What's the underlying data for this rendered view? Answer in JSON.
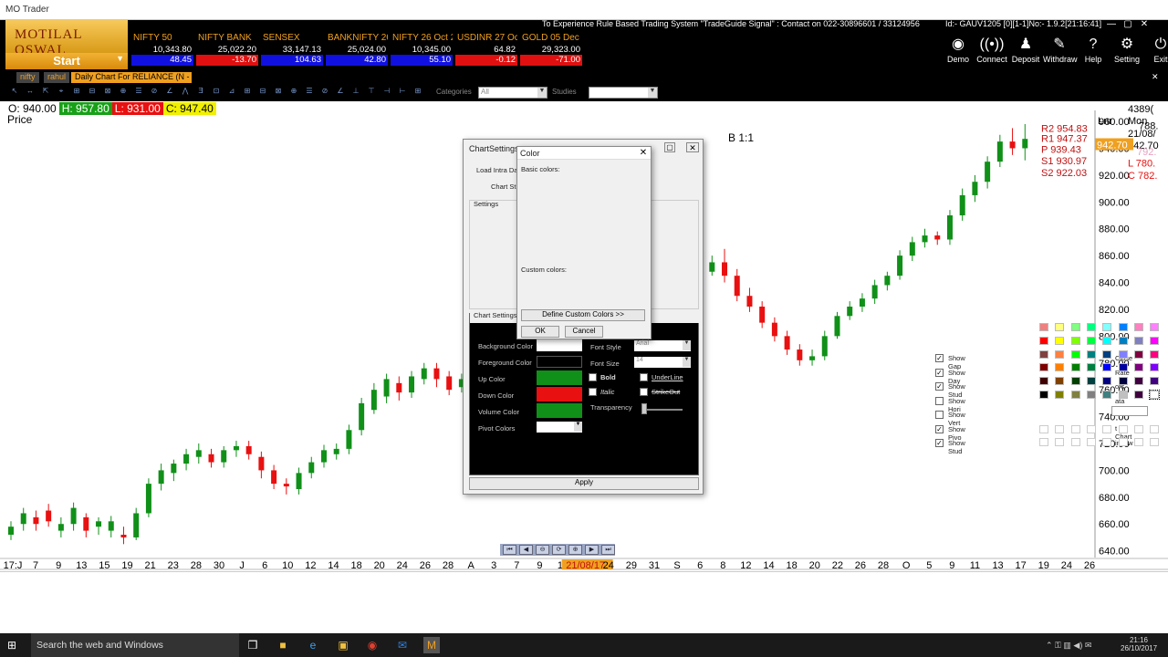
{
  "window": {
    "title": "MO Trader"
  },
  "header": {
    "logo": "MOTILAL OSWAL",
    "start": "Start",
    "marquee": "To Experience Rule Based Trading System \"TradeGuide Signal\" : Contact on 022-30896601 / 33124956",
    "id_text": "Id:- GAUV1205    [0][1-1]No:- 1.9.2[21:16:41]",
    "tickers": [
      {
        "name": "NIFTY 50",
        "value": "10,343.80",
        "change": "48.45",
        "dir": "up"
      },
      {
        "name": "NIFTY BANK",
        "value": "25,022.20",
        "change": "-13.70",
        "dir": "down"
      },
      {
        "name": "SENSEX",
        "value": "33,147.13",
        "change": "104.63",
        "dir": "up"
      },
      {
        "name": "BANKNIFTY 26",
        "value": "25,024.00",
        "change": "42.80",
        "dir": "up"
      },
      {
        "name": "NIFTY 26 Oct 2",
        "value": "10,345.00",
        "change": "55.10",
        "dir": "up"
      },
      {
        "name": "USDINR 27 Oct",
        "value": "64.82",
        "change": "-0.12",
        "dir": "down"
      },
      {
        "name": "GOLD 05 Dec 2",
        "value": "29,323.00",
        "change": "-71.00",
        "dir": "down"
      }
    ],
    "buttons": [
      {
        "label": "Demo",
        "icon": "eye-icon",
        "glyph": "◉"
      },
      {
        "label": "Connect",
        "icon": "signal-icon",
        "glyph": "((•))"
      },
      {
        "label": "Deposit",
        "icon": "deposit-icon",
        "glyph": "♟"
      },
      {
        "label": "Withdraw",
        "icon": "withdraw-icon",
        "glyph": "✎"
      },
      {
        "label": "Help",
        "icon": "help-icon",
        "glyph": "?"
      },
      {
        "label": "Setting",
        "icon": "gear-icon",
        "glyph": "⚙"
      },
      {
        "label": "Exit",
        "icon": "exit-icon",
        "glyph": "⏻"
      }
    ]
  },
  "tabs": {
    "t1": "nifty",
    "t2": "rahul",
    "active": "Daily Chart For RELIANCE (N - 2..."
  },
  "toolbar": {
    "categories_label": "Categories",
    "categories_value": "All",
    "studies_label": "Studies"
  },
  "ohlc": {
    "o": "O: 940.00",
    "h": "H: 957.80",
    "l": "L: 931.00",
    "c": "C: 947.40",
    "price_label": "Price"
  },
  "chart_overlay": {
    "b11": "B 1:1",
    "right_header": [
      "4389(",
      "Mon",
      "21/08/",
      "942.70",
      "Lnr"
    ],
    "levels": [
      "R2 954.83",
      "R1 947.37",
      "P 939.43",
      "S1 930.97",
      "S2 922.03"
    ],
    "right_labels": {
      "l792": "792.",
      "l780": "L 780.",
      "l782": "C 782.",
      "l788": "788.",
      "last": "942.70"
    }
  },
  "chart_data": {
    "type": "candlestick",
    "ylim": [
      635,
      975
    ],
    "y_ticks": [
      "960.00",
      "940.00",
      "920.00",
      "900.00",
      "880.00",
      "860.00",
      "840.00",
      "820.00",
      "800.00",
      "780.00",
      "760.00",
      "740.00",
      "720.00",
      "700.00",
      "680.00",
      "660.00",
      "640.00"
    ],
    "x_ticks": [
      "17:J",
      "7",
      "9",
      "13",
      "15",
      "19",
      "21",
      "23",
      "28",
      "30",
      "J",
      "6",
      "10",
      "12",
      "14",
      "18",
      "20",
      "24",
      "26",
      "28",
      "A",
      "3",
      "7",
      "9",
      "11",
      "21/08/17",
      "24",
      "29",
      "31",
      "S",
      "6",
      "8",
      "12",
      "14",
      "18",
      "20",
      "22",
      "26",
      "28",
      "O",
      "5",
      "9",
      "11",
      "13",
      "17",
      "19",
      "24",
      "26"
    ],
    "highlight_x": "21/08/17",
    "candles": [
      [
        652,
        658,
        648,
        662
      ],
      [
        660,
        668,
        655,
        672
      ],
      [
        665,
        660,
        655,
        670
      ],
      [
        670,
        662,
        658,
        675
      ],
      [
        655,
        660,
        650,
        665
      ],
      [
        660,
        672,
        655,
        676
      ],
      [
        665,
        655,
        650,
        668
      ],
      [
        658,
        662,
        652,
        665
      ],
      [
        655,
        662,
        650,
        666
      ],
      [
        652,
        650,
        645,
        658
      ],
      [
        650,
        668,
        648,
        672
      ],
      [
        668,
        690,
        665,
        694
      ],
      [
        690,
        700,
        685,
        705
      ],
      [
        698,
        705,
        692,
        708
      ],
      [
        705,
        712,
        700,
        716
      ],
      [
        710,
        715,
        705,
        720
      ],
      [
        712,
        706,
        702,
        716
      ],
      [
        706,
        715,
        702,
        718
      ],
      [
        715,
        718,
        710,
        722
      ],
      [
        718,
        712,
        708,
        722
      ],
      [
        710,
        700,
        694,
        714
      ],
      [
        700,
        690,
        686,
        704
      ],
      [
        690,
        688,
        682,
        694
      ],
      [
        686,
        698,
        682,
        702
      ],
      [
        698,
        706,
        694,
        710
      ],
      [
        706,
        715,
        702,
        719
      ],
      [
        712,
        716,
        708,
        720
      ],
      [
        716,
        730,
        712,
        734
      ],
      [
        730,
        750,
        726,
        754
      ],
      [
        745,
        760,
        742,
        765
      ],
      [
        755,
        768,
        750,
        772
      ],
      [
        765,
        758,
        752,
        770
      ],
      [
        758,
        770,
        754,
        774
      ],
      [
        768,
        776,
        764,
        780
      ],
      [
        776,
        768,
        762,
        780
      ],
      [
        770,
        760,
        756,
        774
      ],
      [
        762,
        768,
        758,
        772
      ],
      [
        768,
        782,
        764,
        786
      ],
      [
        782,
        795,
        778,
        798
      ],
      [
        795,
        805,
        790,
        808
      ],
      [
        805,
        798,
        792,
        810
      ],
      [
        798,
        805,
        795,
        808
      ],
      [
        805,
        800,
        796,
        808
      ],
      [
        800,
        795,
        790,
        804
      ],
      [
        795,
        808,
        792,
        812
      ],
      [
        808,
        818,
        805,
        822
      ],
      [
        818,
        812,
        808,
        822
      ],
      [
        812,
        808,
        804,
        816
      ],
      [
        808,
        815,
        804,
        818
      ],
      [
        815,
        822,
        810,
        826
      ],
      [
        822,
        830,
        818,
        834
      ],
      [
        830,
        842,
        826,
        846
      ],
      [
        842,
        848,
        838,
        852
      ],
      [
        848,
        842,
        838,
        854
      ],
      [
        842,
        850,
        838,
        856
      ],
      [
        850,
        848,
        844,
        854
      ],
      [
        848,
        855,
        845,
        860
      ],
      [
        855,
        845,
        840,
        865
      ],
      [
        845,
        830,
        826,
        850
      ],
      [
        830,
        822,
        818,
        836
      ],
      [
        822,
        810,
        806,
        826
      ],
      [
        810,
        800,
        796,
        814
      ],
      [
        800,
        790,
        786,
        804
      ],
      [
        790,
        782,
        778,
        794
      ],
      [
        782,
        785,
        778,
        790
      ],
      [
        785,
        800,
        782,
        804
      ],
      [
        800,
        815,
        798,
        818
      ],
      [
        815,
        822,
        812,
        826
      ],
      [
        822,
        828,
        818,
        832
      ],
      [
        828,
        838,
        824,
        842
      ],
      [
        838,
        845,
        834,
        848
      ],
      [
        845,
        860,
        842,
        864
      ],
      [
        860,
        870,
        856,
        874
      ],
      [
        870,
        875,
        866,
        880
      ],
      [
        875,
        872,
        868,
        878
      ],
      [
        872,
        890,
        868,
        894
      ],
      [
        890,
        905,
        886,
        910
      ],
      [
        905,
        915,
        900,
        920
      ],
      [
        915,
        930,
        910,
        934
      ],
      [
        930,
        945,
        926,
        950
      ],
      [
        945,
        940,
        935,
        955
      ],
      [
        940,
        947,
        931,
        958
      ]
    ]
  },
  "dialogs": {
    "chart_settings": {
      "title": "ChartSettings",
      "load_intra": "Load Intra Da",
      "chart_st": "Chart St",
      "settings_group": "Settings",
      "checks": [
        "Show Gap",
        "Show Day",
        "Show Stud",
        "Show Hori",
        "Show Vert",
        "Show Pivo",
        "Show Stud"
      ],
      "checked": [
        true,
        true,
        true,
        false,
        false,
        true,
        true
      ],
      "right_checks": [
        "Close",
        "Rate",
        "ors",
        "ata Window",
        "t on Chart",
        "indow"
      ],
      "lower_group": "Chart Settings",
      "bg_color": "Background Color",
      "fg_color": "Foreground Color",
      "up_color": "Up Color",
      "down_color": "Down Color",
      "vol_color": "Volume Color",
      "pivot_colors": "Pivot Colors",
      "font_style": "Font Style",
      "font_style_value": "Arial",
      "font_size": "Font Size",
      "font_size_value": "14",
      "bold": "Bold",
      "italic": "Italic",
      "underline": "UnderLine",
      "strikeout": "StrikeOut",
      "transparency": "Transparency",
      "apply": "Apply",
      "colors": {
        "fg": "#000000",
        "up": "#109018",
        "down": "#e81010",
        "vol": "#109018"
      }
    },
    "color": {
      "title": "Color",
      "basic": "Basic colors:",
      "custom": "Custom colors:",
      "define": "Define Custom Colors >>",
      "ok": "OK",
      "cancel": "Cancel",
      "palette": [
        "#f08080",
        "#ffff80",
        "#80ff80",
        "#00ff80",
        "#80ffff",
        "#0080ff",
        "#ff80c0",
        "#ff80ff",
        "#ff0000",
        "#ffff00",
        "#80ff00",
        "#00ff40",
        "#00ffff",
        "#0080c0",
        "#8080c0",
        "#ff00ff",
        "#804040",
        "#ff8040",
        "#00ff00",
        "#008080",
        "#004080",
        "#8080ff",
        "#800040",
        "#ff0080",
        "#800000",
        "#ff8000",
        "#008000",
        "#008040",
        "#0000ff",
        "#0000a0",
        "#800080",
        "#8000ff",
        "#400000",
        "#804000",
        "#004000",
        "#004040",
        "#000080",
        "#000040",
        "#400040",
        "#400080",
        "#000000",
        "#808000",
        "#808040",
        "#808080",
        "#408080",
        "#c0c0c0",
        "#400040",
        "#ffffff"
      ]
    }
  },
  "taskbar": {
    "search": "Search the web and Windows",
    "time": "21:16",
    "date": "26/10/2017"
  }
}
